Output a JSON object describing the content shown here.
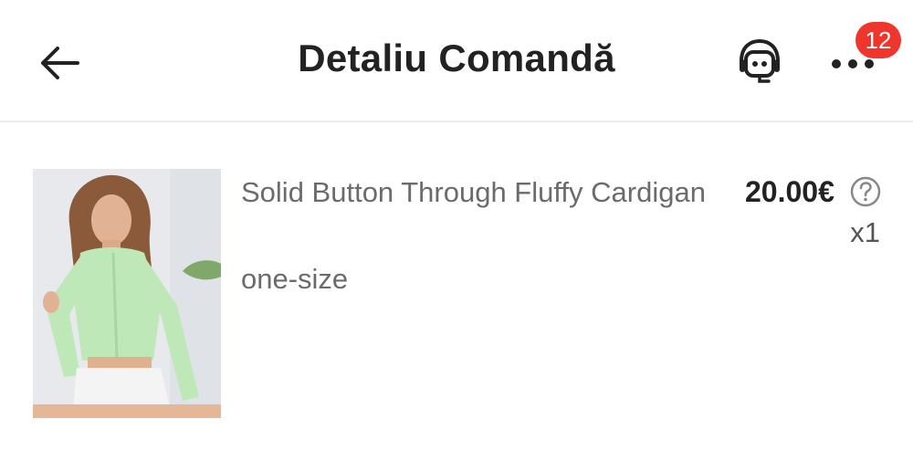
{
  "header": {
    "title": "Detaliu Comandă",
    "back_icon": "arrow-left-icon",
    "support_icon": "robot-headset-icon",
    "more_icon": "more-dots-icon",
    "notification_count": "12",
    "badge_color": "#f0352d"
  },
  "product": {
    "name": "Solid Button Through Fluffy Cardigan",
    "size": "one-size",
    "price": "20.00€",
    "quantity": "x1",
    "help_icon": "question-circle-icon",
    "image_icon": "product-photo-icon"
  }
}
